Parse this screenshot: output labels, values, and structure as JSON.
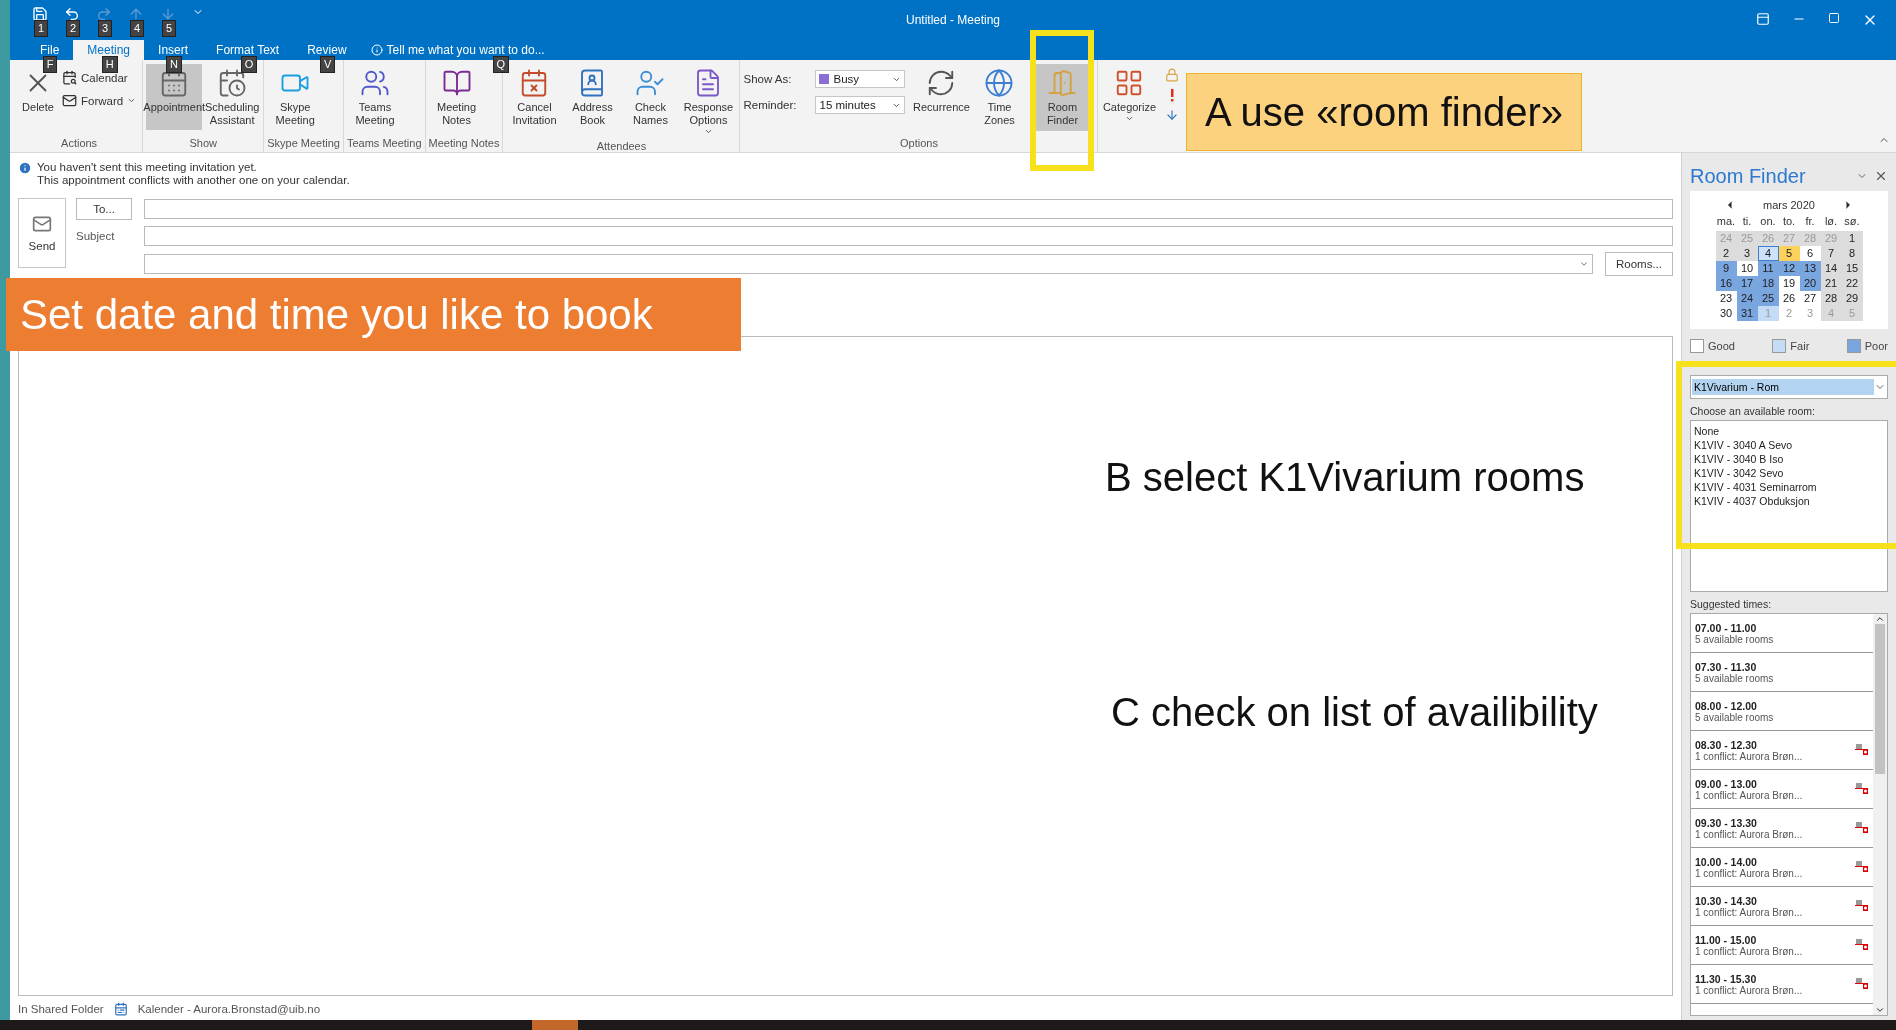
{
  "window": {
    "title": "Untitled - Meeting"
  },
  "quick_access": [
    {
      "keytip": "1",
      "disabled": false
    },
    {
      "keytip": "2",
      "disabled": false
    },
    {
      "keytip": "3",
      "disabled": true
    },
    {
      "keytip": "4",
      "disabled": true
    },
    {
      "keytip": "5",
      "disabled": true
    }
  ],
  "tabs": [
    {
      "label": "File",
      "keytip": "F",
      "selected": false
    },
    {
      "label": "Meeting",
      "keytip": "H",
      "selected": true
    },
    {
      "label": "Insert",
      "keytip": "N",
      "selected": false
    },
    {
      "label": "Format Text",
      "keytip": "O",
      "selected": false
    },
    {
      "label": "Review",
      "keytip": "V",
      "selected": false
    }
  ],
  "tell_me": {
    "placeholder": "Tell me what you want to do...",
    "keytip": "Q"
  },
  "ribbon": {
    "groups": [
      {
        "label": "Actions",
        "items": [
          {
            "kind": "large",
            "label": "Delete",
            "selected": false
          },
          {
            "kind": "stack",
            "children": [
              {
                "label": "Calendar"
              },
              {
                "label": "Forward",
                "dropdown": true
              }
            ]
          }
        ]
      },
      {
        "label": "Show",
        "items": [
          {
            "kind": "large",
            "label": "Appointment",
            "selected": true
          },
          {
            "kind": "large",
            "label": "Scheduling Assistant",
            "selected": false
          }
        ]
      },
      {
        "label": "Skype Meeting",
        "items": [
          {
            "kind": "large",
            "label": "Skype Meeting",
            "selected": false
          }
        ]
      },
      {
        "label": "Teams Meeting",
        "items": [
          {
            "kind": "large",
            "label": "Teams Meeting",
            "selected": false
          }
        ]
      },
      {
        "label": "Meeting Notes",
        "items": [
          {
            "kind": "large",
            "label": "Meeting Notes",
            "selected": false
          }
        ]
      },
      {
        "label": "Attendees",
        "items": [
          {
            "kind": "large",
            "label": "Cancel Invitation",
            "selected": false
          },
          {
            "kind": "large",
            "label": "Address Book",
            "selected": false
          },
          {
            "kind": "large",
            "label": "Check Names",
            "selected": false
          },
          {
            "kind": "large",
            "label": "Response Options",
            "selected": false,
            "dropdown": true
          }
        ]
      },
      {
        "label": "Options",
        "items": [
          {
            "kind": "fields",
            "children": [
              {
                "label": "Show As:",
                "value": "Busy"
              },
              {
                "label": "Reminder:",
                "value": "15 minutes"
              }
            ]
          },
          {
            "kind": "large",
            "label": "Recurrence",
            "selected": false
          },
          {
            "kind": "large",
            "label": "Time Zones",
            "selected": false
          },
          {
            "kind": "large",
            "label": "Room Finder",
            "selected": true,
            "highlight": true
          }
        ]
      },
      {
        "items": [
          {
            "kind": "large",
            "label": "Categorize",
            "selected": false,
            "dropdown": true
          },
          {
            "kind": "tags"
          }
        ]
      }
    ]
  },
  "compose": {
    "info": [
      "You haven't sent this meeting invitation yet.",
      "This appointment conflicts with another one on your calendar."
    ],
    "send": "Send",
    "to": "To...",
    "subject_label": "Subject",
    "rooms": "Rooms...",
    "status_folder": "In Shared Folder",
    "status_calendar": "Kalender - Aurora.Bronstad@uib.no"
  },
  "room_finder": {
    "title": "Room Finder",
    "month": "mars 2020",
    "weekdays": [
      "ma.",
      "ti.",
      "on.",
      "to.",
      "fr.",
      "lø.",
      "sø."
    ],
    "weeks": [
      [
        {
          "day": "24",
          "color": "#dcdcdc",
          "muted": true,
          "selected": false
        },
        {
          "day": "25",
          "color": "#dcdcdc",
          "muted": true,
          "selected": false
        },
        {
          "day": "26",
          "color": "#dcdcdc",
          "muted": true,
          "selected": false
        },
        {
          "day": "27",
          "color": "#dcdcdc",
          "muted": true,
          "selected": false
        },
        {
          "day": "28",
          "color": "#dcdcdc",
          "muted": true,
          "selected": false
        },
        {
          "day": "29",
          "color": "#dcdcdc",
          "muted": true,
          "selected": false
        },
        {
          "day": "1",
          "color": "#dcdcdc",
          "muted": false,
          "selected": false
        }
      ],
      [
        {
          "day": "2",
          "color": "#dcdcdc",
          "muted": false,
          "selected": false
        },
        {
          "day": "3",
          "color": "#dcdcdc",
          "muted": false,
          "selected": false
        },
        {
          "day": "4",
          "color": "#cde2f8",
          "muted": false,
          "selected": true
        },
        {
          "day": "5",
          "color": "#fcd15c",
          "muted": false,
          "selected": false
        },
        {
          "day": "6",
          "color": "#ffffff",
          "muted": false,
          "selected": false
        },
        {
          "day": "7",
          "color": "#dcdcdc",
          "muted": false,
          "selected": false
        },
        {
          "day": "8",
          "color": "#dcdcdc",
          "muted": false,
          "selected": false
        }
      ],
      [
        {
          "day": "9",
          "color": "#7aa6e0",
          "muted": false,
          "selected": false
        },
        {
          "day": "10",
          "color": "#ffffff",
          "muted": false,
          "selected": false
        },
        {
          "day": "11",
          "color": "#7aa6e0",
          "muted": false,
          "selected": false
        },
        {
          "day": "12",
          "color": "#7aa6e0",
          "muted": false,
          "selected": false
        },
        {
          "day": "13",
          "color": "#7aa6e0",
          "muted": false,
          "selected": false
        },
        {
          "day": "14",
          "color": "#dcdcdc",
          "muted": false,
          "selected": false
        },
        {
          "day": "15",
          "color": "#dcdcdc",
          "muted": false,
          "selected": false
        }
      ],
      [
        {
          "day": "16",
          "color": "#7aa6e0",
          "muted": false,
          "selected": false
        },
        {
          "day": "17",
          "color": "#7aa6e0",
          "muted": false,
          "selected": false
        },
        {
          "day": "18",
          "color": "#7aa6e0",
          "muted": false,
          "selected": false
        },
        {
          "day": "19",
          "color": "#ffffff",
          "muted": false,
          "selected": false
        },
        {
          "day": "20",
          "color": "#7aa6e0",
          "muted": false,
          "selected": false
        },
        {
          "day": "21",
          "color": "#dcdcdc",
          "muted": false,
          "selected": false
        },
        {
          "day": "22",
          "color": "#dcdcdc",
          "muted": false,
          "selected": false
        }
      ],
      [
        {
          "day": "23",
          "color": "#ffffff",
          "muted": false,
          "selected": false
        },
        {
          "day": "24",
          "color": "#7aa6e0",
          "muted": false,
          "selected": false
        },
        {
          "day": "25",
          "color": "#7aa6e0",
          "muted": false,
          "selected": false
        },
        {
          "day": "26",
          "color": "#ffffff",
          "muted": false,
          "selected": false
        },
        {
          "day": "27",
          "color": "#ffffff",
          "muted": false,
          "selected": false
        },
        {
          "day": "28",
          "color": "#dcdcdc",
          "muted": false,
          "selected": false
        },
        {
          "day": "29",
          "color": "#dcdcdc",
          "muted": false,
          "selected": false
        }
      ],
      [
        {
          "day": "30",
          "color": "#ffffff",
          "muted": false,
          "selected": false
        },
        {
          "day": "31",
          "color": "#7aa6e0",
          "muted": false,
          "selected": false
        },
        {
          "day": "1",
          "color": "#c5dcf7",
          "muted": true,
          "selected": false
        },
        {
          "day": "2",
          "color": "#ffffff",
          "muted": true,
          "selected": false
        },
        {
          "day": "3",
          "color": "#ffffff",
          "muted": true,
          "selected": false
        },
        {
          "day": "4",
          "color": "#dcdcdc",
          "muted": true,
          "selected": false
        },
        {
          "day": "5",
          "color": "#dcdcdc",
          "muted": true,
          "selected": false
        }
      ]
    ],
    "legend": [
      {
        "label": "Good",
        "color": "#ffffff"
      },
      {
        "label": "Fair",
        "color": "#c5dcf7"
      },
      {
        "label": "Poor",
        "color": "#7aa6e0"
      }
    ],
    "room_list": {
      "value": "K1Vivarium - Rom"
    },
    "rooms_label": "Choose an available room:",
    "rooms": [
      {
        "name": "None",
        "selected": false
      },
      {
        "name": "K1VIV - 3040 A Sevo",
        "selected": false
      },
      {
        "name": "K1VIV - 3040 B Iso",
        "selected": false
      },
      {
        "name": "K1VIV - 3042 Sevo",
        "selected": false
      },
      {
        "name": "K1VIV - 4031 Seminarrom",
        "selected": false
      },
      {
        "name": "K1VIV - 4037 Obduksjon",
        "selected": false
      }
    ],
    "suggested_label": "Suggested times:",
    "suggested": [
      {
        "time": "07.00 - 11.00",
        "detail": "5 available rooms",
        "conflict": false
      },
      {
        "time": "07.30 - 11.30",
        "detail": "5 available rooms",
        "conflict": false
      },
      {
        "time": "08.00 - 12.00",
        "detail": "5 available rooms",
        "conflict": false
      },
      {
        "time": "08.30 - 12.30",
        "detail": "1 conflict: Aurora Brøn...",
        "conflict": true
      },
      {
        "time": "09.00 - 13.00",
        "detail": "1 conflict: Aurora Brøn...",
        "conflict": true
      },
      {
        "time": "09.30 - 13.30",
        "detail": "1 conflict: Aurora Brøn...",
        "conflict": true
      },
      {
        "time": "10.00 - 14.00",
        "detail": "1 conflict: Aurora Brøn...",
        "conflict": true
      },
      {
        "time": "10.30 - 14.30",
        "detail": "1 conflict: Aurora Brøn...",
        "conflict": true
      },
      {
        "time": "11.00 - 15.00",
        "detail": "1 conflict: Aurora Brøn...",
        "conflict": true
      },
      {
        "time": "11.30 - 15.30",
        "detail": "1 conflict: Aurora Brøn...",
        "conflict": true
      }
    ]
  },
  "annotations": [
    {
      "kind": "yellow",
      "text": "A use «room finder»"
    },
    {
      "kind": "orange",
      "text": "Set date and time you like to book"
    },
    {
      "kind": "plain",
      "text": "B select K1Vivarium rooms"
    },
    {
      "kind": "plain",
      "text": "C check on list of availibility"
    }
  ]
}
